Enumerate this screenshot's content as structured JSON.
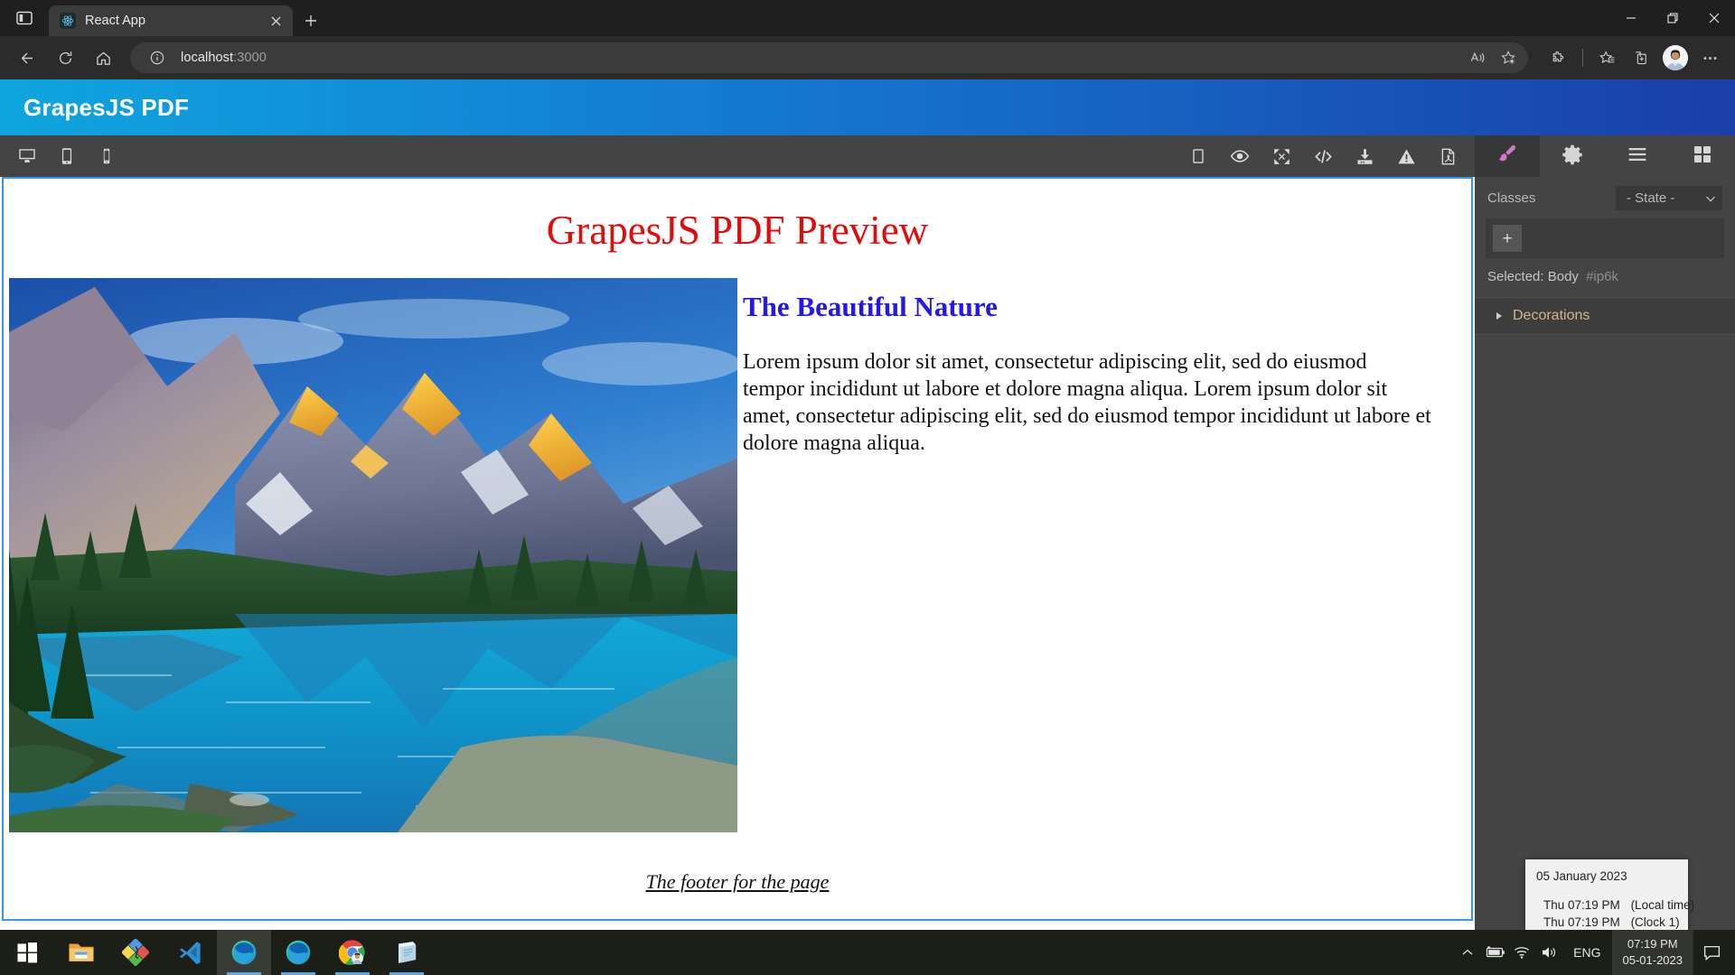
{
  "browser": {
    "tab_sidebar_icon": "tab-actions-icon",
    "tab": {
      "title": "React App",
      "favicon": "react-logo-icon",
      "close": "close-icon"
    },
    "new_tab": "new-tab-icon",
    "window_controls": {
      "minimize": "minimize-icon",
      "restore": "restore-icon",
      "close": "close-icon"
    },
    "nav": {
      "back": "back-arrow-icon",
      "refresh": "refresh-icon",
      "home": "home-icon"
    },
    "omnibox": {
      "info_icon": "site-info-icon",
      "url_host": "localhost",
      "url_port": ":3000",
      "read_aloud": "read-aloud-icon",
      "add_favorite": "add-favorite-icon"
    },
    "toolbar_right": {
      "extensions": "extensions-puzzle-icon",
      "favorites": "favorites-star-icon",
      "collections": "collections-icon",
      "profile": "profile-avatar",
      "settings": "more-options-icon"
    }
  },
  "app": {
    "header_title": "GrapesJS PDF",
    "devices": [
      {
        "name": "device-desktop",
        "icon": "desktop-icon"
      },
      {
        "name": "device-tablet",
        "icon": "tablet-icon"
      },
      {
        "name": "device-mobile",
        "icon": "mobile-icon"
      }
    ],
    "options": [
      {
        "name": "toggle-borders",
        "icon": "square-borders-icon"
      },
      {
        "name": "preview",
        "icon": "eye-icon"
      },
      {
        "name": "fullscreen",
        "icon": "fullscreen-icon"
      },
      {
        "name": "export-code",
        "icon": "code-icon"
      },
      {
        "name": "import-download",
        "icon": "download-icon"
      },
      {
        "name": "clear-canvas",
        "icon": "warning-triangle-icon"
      },
      {
        "name": "export-pdf",
        "icon": "pdf-file-icon"
      }
    ],
    "panel_switcher": [
      {
        "name": "open-style-manager",
        "icon": "paint-brush-icon",
        "active": true
      },
      {
        "name": "open-settings-traits",
        "icon": "gear-icon",
        "active": false
      },
      {
        "name": "open-layer-manager",
        "icon": "hamburger-layers-icon",
        "active": false
      },
      {
        "name": "open-blocks",
        "icon": "blocks-grid-icon",
        "active": false
      }
    ]
  },
  "document": {
    "title": "GrapesJS PDF Preview",
    "heading": "The Beautiful Nature",
    "paragraph": "Lorem ipsum dolor sit amet, consectetur adipiscing elit, sed do eiusmod tempor incididunt ut labore et dolore magna aliqua. Lorem ipsum dolor sit amet, consectetur adipiscing elit, sed do eiusmod tempor incididunt ut labore et dolore magna aliqua.",
    "footer": "The footer for the page",
    "image_alt": "mountain-lake-photo"
  },
  "style_panel": {
    "classes_label": "Classes",
    "state_value": "- State -",
    "add_class_label": "+",
    "selected_label": "Selected:",
    "selected_target": "Body",
    "selected_id": "#ip6k",
    "sectors": [
      {
        "label": "Decorations",
        "expanded": false
      }
    ]
  },
  "clock_flyout": {
    "date": "05 January 2023",
    "local_time": "Thu 07:19 PM",
    "local_label": "(Local time)",
    "clock1_time": "Thu 07:19 PM",
    "clock1_label": "(Clock 1)"
  },
  "taskbar": {
    "apps": [
      {
        "name": "start-button",
        "icon": "windows-logo-icon",
        "active": false,
        "running": false
      },
      {
        "name": "file-explorer",
        "icon": "folder-icon",
        "active": false,
        "running": true
      },
      {
        "name": "paint-app",
        "icon": "paint-diamond-icon",
        "active": false,
        "running": true
      },
      {
        "name": "vs-code",
        "icon": "vscode-icon",
        "active": false,
        "running": true
      },
      {
        "name": "microsoft-edge-active",
        "icon": "edge-icon",
        "active": true,
        "running": true
      },
      {
        "name": "microsoft-edge",
        "icon": "edge-icon",
        "active": false,
        "running": true
      },
      {
        "name": "google-chrome",
        "icon": "chrome-icon",
        "active": false,
        "running": true
      },
      {
        "name": "sticky-notes",
        "icon": "notes-icon",
        "active": false,
        "running": true
      }
    ],
    "tray": {
      "show_hidden": "chevron-up-icon",
      "battery": "battery-charging-icon",
      "network": "wifi-icon",
      "volume": "speaker-icon",
      "language": "ENG",
      "time": "07:19 PM",
      "date": "05-01-2023",
      "notifications": "notification-icon"
    }
  },
  "colors": {
    "header_gradient_start": "#0ea5e0",
    "header_gradient_end": "#1a3fa8",
    "doc_title": "#e20b0b",
    "doc_heading": "#2318e8",
    "canvas_outline": "#3b97e3",
    "panel_bg": "#444444",
    "brush_accent": "#d278c9"
  }
}
